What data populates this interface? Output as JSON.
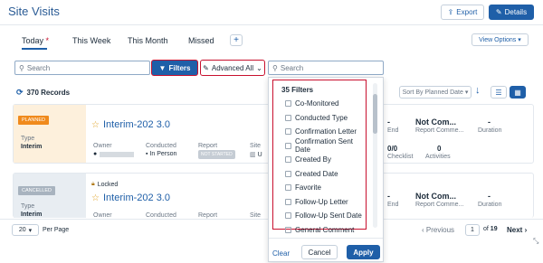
{
  "header": {
    "title": "Site Visits",
    "export_label": "Export",
    "details_label": "Details"
  },
  "tabs": [
    {
      "label": "Today",
      "marker": "*"
    },
    {
      "label": "This Week"
    },
    {
      "label": "This Month"
    },
    {
      "label": "Missed"
    }
  ],
  "view_options_label": "View Options",
  "search": {
    "placeholder": "Search"
  },
  "filters_label": "Filters",
  "advanced_label": "Advanced All",
  "search2": {
    "placeholder": "Search"
  },
  "records_label": "370 Records",
  "sort_label": "Sort By Planned Date",
  "cards": [
    {
      "status": "PLANNED",
      "type_label": "Type",
      "type_value": "Interim",
      "title": "Interim-202 3.0",
      "owner_label": "Owner",
      "conducted_label": "Conducted",
      "conducted_value": "In Person",
      "report_label": "Report",
      "report_value": "NOT STARTED",
      "site_label": "Site",
      "site_value": "U",
      "end_label": "End",
      "report_comment_value": "Not Com...",
      "report_comment_label": "Report Comme...",
      "duration_value": "-",
      "duration_label": "Duration",
      "end_value": "-",
      "checklist_value": "0/0",
      "checklist_label": "Checklist",
      "activities_value": "0",
      "activities_label": "Activities"
    },
    {
      "status": "CANCELLED",
      "locked_label": "Locked",
      "type_label": "Type",
      "type_value": "Interim",
      "title": "Interim-202 3.0",
      "owner_label": "Owner",
      "conducted_label": "Conducted",
      "report_label": "Report",
      "site_label": "Site",
      "end_value": "-",
      "end_label": "End",
      "report_comment_value": "Not Com...",
      "report_comment_label": "Report Comme...",
      "duration_value": "-",
      "duration_label": "Duration"
    }
  ],
  "filter_panel": {
    "header": "35  Filters",
    "items": [
      "Co-Monitored",
      "Conducted Type",
      "Confirmation Letter",
      "Confirmation Sent Date",
      "Created By",
      "Created Date",
      "Favorite",
      "Follow-Up Letter",
      "Follow-Up Sent Date",
      "General Comment"
    ],
    "clear_label": "Clear",
    "cancel_label": "Cancel",
    "apply_label": "Apply"
  },
  "pagination": {
    "per_page_value": "20",
    "per_page_label": "Per Page",
    "previous_label": "Previous",
    "current_page": "1",
    "of_label": "of",
    "total_pages": "19",
    "next_label": "Next"
  },
  "colors": {
    "accent": "#1f5fa8",
    "highlight": "#c8102e",
    "planned": "#f08a1c",
    "cancelled": "#9aa6b2"
  }
}
